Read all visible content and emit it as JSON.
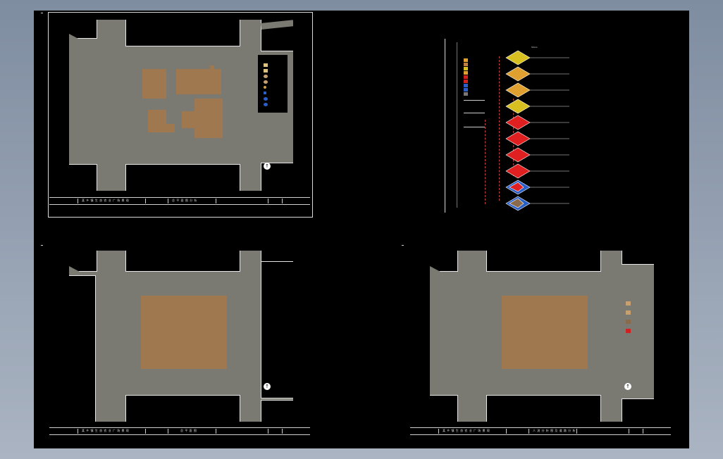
{
  "sheets": {
    "tl": {
      "title_block": {
        "project": "某 乡 镇 生 态 农 业 广 场 景 观",
        "drawing": "总 平 面 图 分 析"
      }
    },
    "tr": {
      "diagram": {
        "top_label": "Stairs"
      }
    },
    "bl": {
      "title_block": {
        "project": "某 乡 镇 生 态 农 业 广 场 景 观",
        "drawing": "总 平 面 图"
      }
    },
    "br": {
      "title_block": {
        "project": "某 乡 镇 生 态 农 业 广 场 景 观",
        "drawing": "人 流 分 析 图 及 道 路 分 析"
      }
    }
  },
  "colors": {
    "background": "#000000",
    "site_gray": "#7a7a72",
    "building": "#a07850",
    "legend_tan": "#c8a070",
    "legend_brown": "#8a6a4a",
    "legend_red": "#d02020",
    "legend_blue": "#2a5fc8",
    "diagram_red": "#e02020",
    "diagram_yellow": "#d8c020",
    "diagram_orange": "#e0a030"
  },
  "icons": [
    "north-arrow-icon",
    "sheet-marker-icon"
  ]
}
